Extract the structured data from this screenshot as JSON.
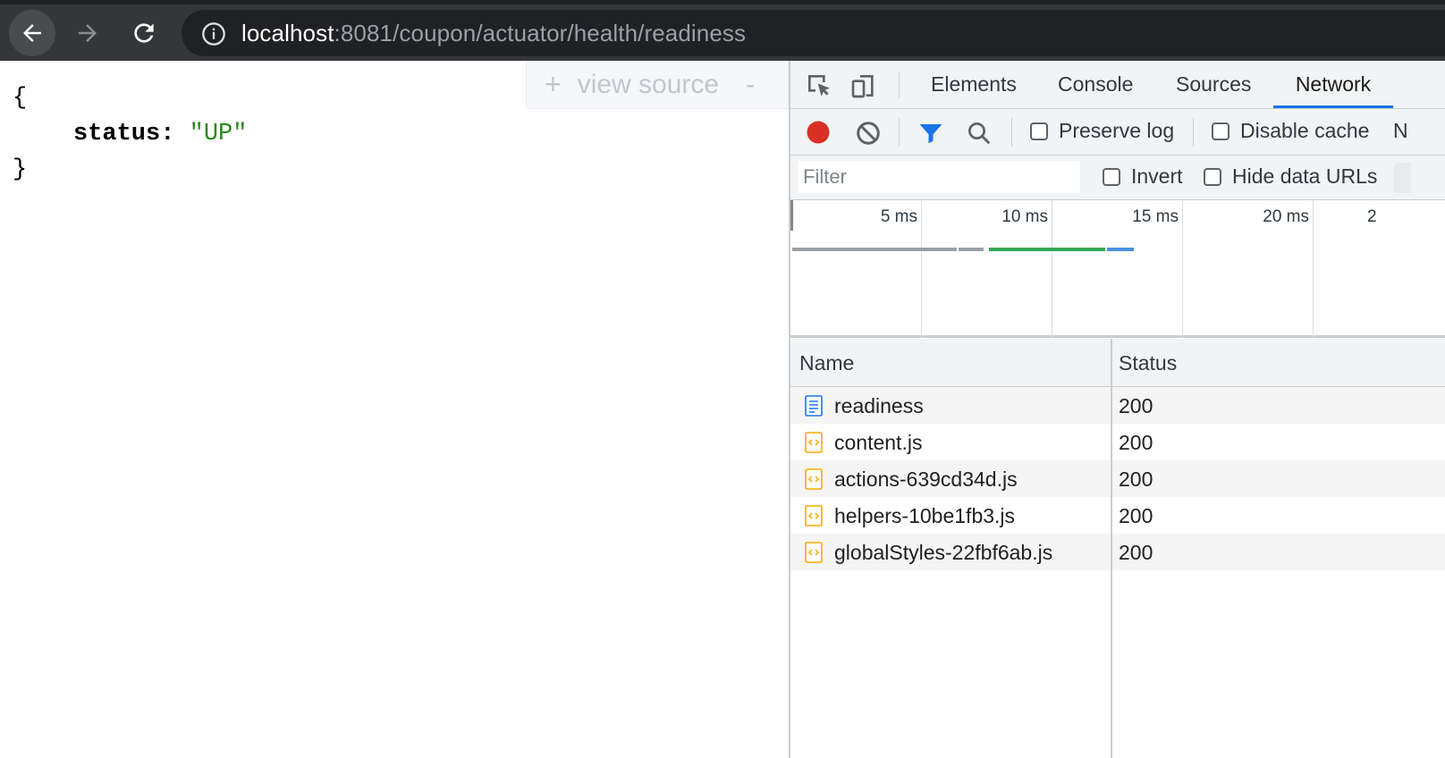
{
  "browser": {
    "url_host": "localhost",
    "url_path": ":8081/coupon/actuator/health/readiness",
    "buttons": {
      "back": "back-arrow-icon",
      "forward": "forward-arrow-icon",
      "reload": "reload-icon"
    }
  },
  "page": {
    "open_brace": "{",
    "close_brace": "}",
    "key": "status:",
    "value": "\"UP\"",
    "view_source": {
      "plus": "+",
      "label": "view source",
      "minus": "-"
    }
  },
  "devtools": {
    "tabs": [
      {
        "label": "Elements"
      },
      {
        "label": "Console"
      },
      {
        "label": "Sources"
      },
      {
        "label": "Network",
        "active": true
      }
    ],
    "controls": {
      "preserve_log": "Preserve log",
      "disable_cache": "Disable cache",
      "overflow": "N"
    },
    "filter": {
      "placeholder": "Filter",
      "invert": "Invert",
      "hide_data_urls": "Hide data URLs"
    },
    "timeline": {
      "ticks": [
        "5 ms",
        "10 ms",
        "15 ms",
        "20 ms",
        "2"
      ]
    },
    "table": {
      "headers": {
        "name": "Name",
        "status": "Status"
      },
      "rows": [
        {
          "name": "readiness",
          "status": "200",
          "type": "document"
        },
        {
          "name": "content.js",
          "status": "200",
          "type": "script"
        },
        {
          "name": "actions-639cd34d.js",
          "status": "200",
          "type": "script"
        },
        {
          "name": "helpers-10be1fb3.js",
          "status": "200",
          "type": "script"
        },
        {
          "name": "globalStyles-22fbf6ab.js",
          "status": "200",
          "type": "script"
        }
      ]
    },
    "colors": {
      "record": "#d93025",
      "accent": "#1a73e8",
      "script_icon": "#f9ab00",
      "json_string": "#2a8a1a"
    }
  }
}
